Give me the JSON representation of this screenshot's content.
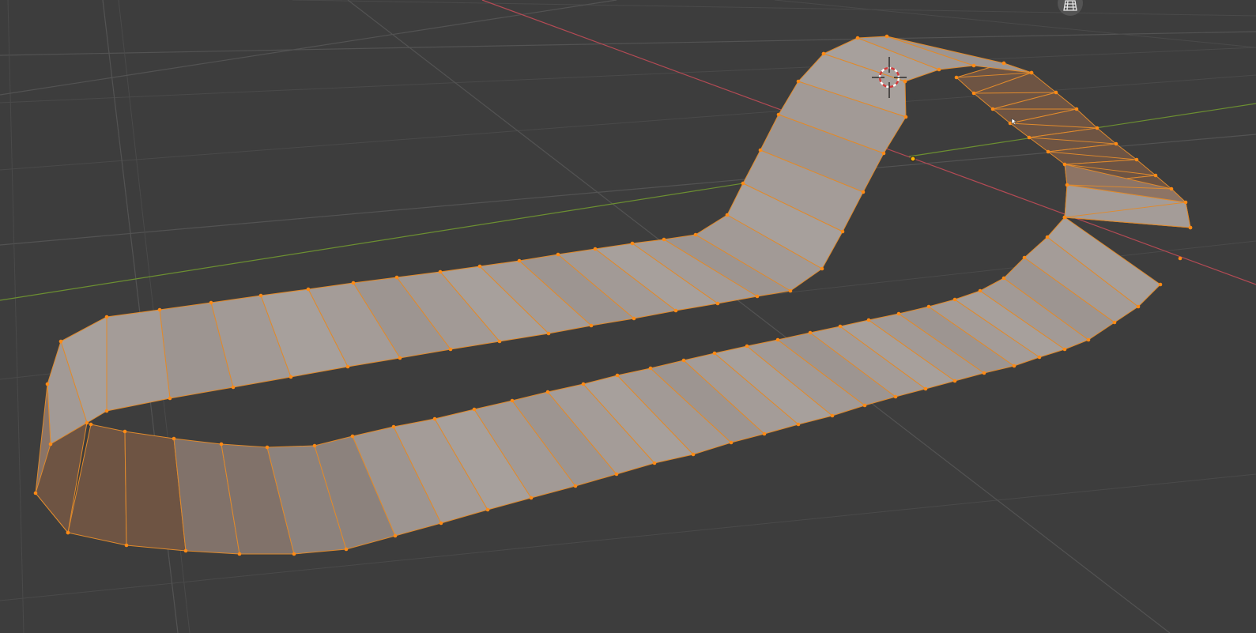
{
  "viewport": {
    "background": "#3d3d3d",
    "mesh_fill": "#a49c98",
    "mesh_dark_fill": "#6e5443",
    "selection_color": "#ff8a14",
    "edge_color": "#e08a2c",
    "x_axis_color": "#b34a54",
    "y_axis_color": "#6c8f31"
  },
  "overlay": {
    "gizmo_icon": "grid-toggle-icon",
    "cursor_icon": "3d-cursor-icon",
    "origin_icon": "object-origin-icon",
    "mouse_icon": "mouse-pointer-icon"
  }
}
